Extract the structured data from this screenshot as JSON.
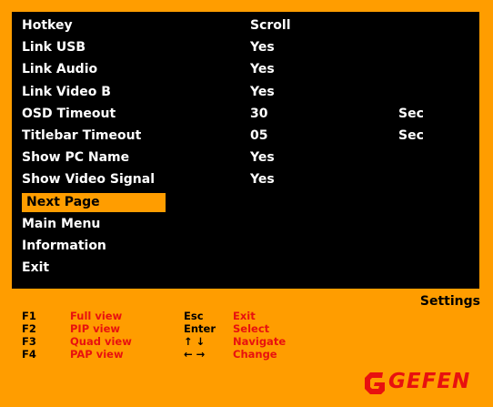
{
  "menu": {
    "items": [
      {
        "label": "Hotkey",
        "value": "Scroll",
        "unit": ""
      },
      {
        "label": "Link USB",
        "value": "Yes",
        "unit": ""
      },
      {
        "label": "Link Audio",
        "value": "Yes",
        "unit": ""
      },
      {
        "label": "Link Video B",
        "value": "Yes",
        "unit": ""
      },
      {
        "label": "OSD Timeout",
        "value": "30",
        "unit": "Sec"
      },
      {
        "label": "Titlebar Timeout",
        "value": "05",
        "unit": "Sec"
      },
      {
        "label": "Show PC Name",
        "value": "Yes",
        "unit": ""
      },
      {
        "label": "Show Video Signal",
        "value": "Yes",
        "unit": ""
      },
      {
        "label": "Next Page",
        "value": "",
        "unit": ""
      },
      {
        "label": "Main Menu",
        "value": "",
        "unit": ""
      },
      {
        "label": "Information",
        "value": "",
        "unit": ""
      },
      {
        "label": "Exit",
        "value": "",
        "unit": ""
      }
    ],
    "selected_label": "Next Page"
  },
  "screen_title": "Settings",
  "legend": [
    {
      "key": "F1",
      "action": "Full view",
      "key2": "Esc",
      "action2": "Exit"
    },
    {
      "key": "F2",
      "action": "PIP view",
      "key2": "Enter",
      "action2": "Select"
    },
    {
      "key": "F3",
      "action": "Quad view",
      "key2": "↑ ↓",
      "action2": "Navigate"
    },
    {
      "key": "F4",
      "action": "PAP view",
      "key2": "← →",
      "action2": "Change"
    }
  ],
  "logo": {
    "text": "GEFEN"
  },
  "colors": {
    "background": "#ff9d00",
    "panel": "#000000",
    "text": "#ffffff",
    "highlight": "#ff9d00",
    "accent_red": "#e8110f"
  }
}
